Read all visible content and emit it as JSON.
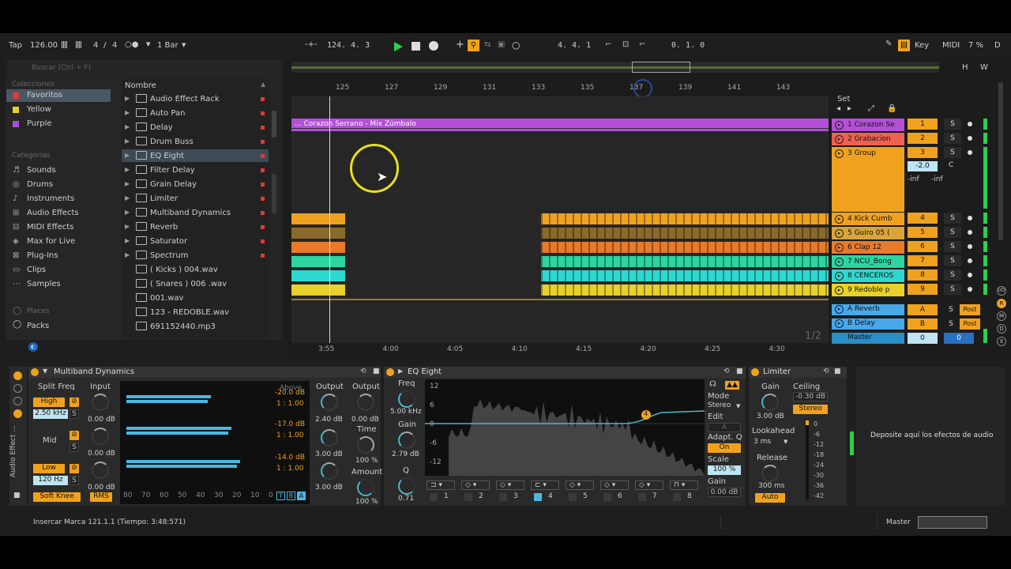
{
  "transport": {
    "tap": "Tap",
    "tempo": "126.00",
    "sig_num": "4",
    "sig_sep": "/",
    "sig_den": "4",
    "quant": "1 Bar",
    "position": "124.  4.  3",
    "loop_pos": "4.  4.  1",
    "loop_len": "0.  1.  0",
    "key": "Key",
    "midi": "MIDI",
    "cpu": "7 %",
    "d": "D"
  },
  "browser": {
    "search_placeholder": "Buscar (Ctrl + F)",
    "collections_title": "Colecciones",
    "collections": [
      {
        "label": "Favoritos",
        "color": "#e03a3a"
      },
      {
        "label": "Yellow",
        "color": "#e8d12a"
      },
      {
        "label": "Purple",
        "color": "#a64fd6"
      }
    ],
    "categories_title": "Categorías",
    "categories": [
      "Sounds",
      "Drums",
      "Instruments",
      "Audio Effects",
      "MIDI Effects",
      "Max for Live",
      "Plug-Ins",
      "Clips",
      "Samples"
    ],
    "places_title": "Places",
    "places": [
      "Packs"
    ],
    "name_header": "Nombre",
    "items": [
      "Audio Effect Rack",
      "Auto Pan",
      "Delay",
      "Drum Buss",
      "EQ Eight",
      "Filter Delay",
      "Grain Delay",
      "Limiter",
      "Multiband Dynamics",
      "Reverb",
      "Saturator",
      "Spectrum",
      "( Kicks ) 004.wav",
      "( Snares ) 006 .wav",
      "001.wav",
      "123 - REDOBLE.wav",
      "691152440.mp3"
    ]
  },
  "arrangement": {
    "ruler": [
      "125",
      "127",
      "129",
      "131",
      "133",
      "135",
      "137",
      "139",
      "141",
      "143"
    ],
    "time": [
      "3:55",
      "4:00",
      "4:05",
      "4:10",
      "4:15",
      "4:20",
      "4:25",
      "4:30"
    ],
    "clip_name": "... Corazon Serrano - Mix Zúmbalo",
    "set": "Set",
    "page": "1/2",
    "hw": [
      "H",
      "W"
    ]
  },
  "tracks": [
    {
      "name": "1 Corazon Se",
      "num": "1",
      "color": "#b44fd8"
    },
    {
      "name": "2 Grabacion",
      "num": "2",
      "color": "#f06050"
    },
    {
      "name": "3 Group",
      "num": "3",
      "color": "#f0a21f"
    },
    {
      "name": "4 Kick Cumb",
      "num": "4",
      "color": "#f0a21f"
    },
    {
      "name": "5 Guiro 05 (",
      "num": "5",
      "color": "#d9a53a"
    },
    {
      "name": "6 Clap 12",
      "num": "6",
      "color": "#e87a2a"
    },
    {
      "name": "7 NCU_Bong",
      "num": "7",
      "color": "#2bd6a0"
    },
    {
      "name": "8 CENCEROS",
      "num": "8",
      "color": "#2ed8d0"
    },
    {
      "name": "9 Redoble p",
      "num": "9",
      "color": "#e8d12a"
    }
  ],
  "returns": [
    {
      "name": "A Reverb",
      "num": "A",
      "post": "Post"
    },
    {
      "name": "B Delay",
      "num": "B",
      "post": "Post"
    }
  ],
  "master": {
    "name": "Master",
    "a": "0",
    "b": "0"
  },
  "group_mixer": {
    "vol": "-2.0",
    "pan": "C",
    "l": "-inf",
    "r": "-inf"
  },
  "solo": "S",
  "chain_title": "Audio Effect ...",
  "multiband": {
    "title": "Multiband Dynamics",
    "split_freq": "Split Freq",
    "input": "Input",
    "output": "Output",
    "high": "High",
    "high_freq": "2.50 kHz",
    "mid": "Mid",
    "low": "Low",
    "low_freq": "120 Hz",
    "in_vals": [
      "0.00 dB",
      "0.00 dB",
      "0.00 dB"
    ],
    "above": "Above",
    "thr": [
      "-20.0 dB",
      "-17.0 dB",
      "-14.0 dB"
    ],
    "ratio": [
      "1 : 1.00",
      "1 : 1.00",
      "1 : 1.00"
    ],
    "out_vals": [
      "2.40 dB",
      "3.00 dB",
      "3.00 dB"
    ],
    "out2": "0.00 dB",
    "time": "Time",
    "time_val": "100 %",
    "amount": "Amount",
    "amount_val": "100 %",
    "scale": [
      "80",
      "70",
      "60",
      "50",
      "40",
      "30",
      "20",
      "10",
      "0"
    ],
    "tba": [
      "T",
      "B",
      "A"
    ],
    "soft_knee": "Soft Knee",
    "rms": "RMS",
    "meter_levels": [
      0.72,
      0.9,
      0.97
    ]
  },
  "eq": {
    "title": "EQ Eight",
    "freq": "Freq",
    "freq_val": "5.00 kHz",
    "gain": "Gain",
    "gain_val": "2.79 dB",
    "q": "Q",
    "q_val": "0.71",
    "db_ticks": [
      "12",
      "6",
      "0",
      "-6",
      "-12"
    ],
    "hz_ticks": [
      "100",
      "1k",
      "10k"
    ],
    "mode": "Mode",
    "mode_val": "Stereo",
    "edit": "Edit",
    "edit_val": "A",
    "adapt": "Adapt. Q",
    "adapt_val": "On",
    "scale": "Scale",
    "scale_val": "100 %",
    "gain2": "Gain",
    "gain2_val": "0.00 dB",
    "bands": [
      "1",
      "2",
      "3",
      "4",
      "5",
      "6",
      "7",
      "8"
    ],
    "active_band": "4"
  },
  "limiter": {
    "title": "Limiter",
    "gain": "Gain",
    "gain_val": "3.00 dB",
    "ceiling": "Ceiling",
    "ceiling_val": "-0.30 dB",
    "stereo": "Stereo",
    "lookahead": "Lookahead",
    "lookahead_val": "3 ms",
    "release": "Release",
    "release_val": "300 ms",
    "auto": "Auto",
    "scale": [
      "0",
      "-6",
      "-12",
      "-18",
      "-24",
      "-30",
      "-36",
      "-42"
    ]
  },
  "drop_hint": "Deposite aquí los efectos de audio",
  "status": {
    "text": "Insercar Marca 121.1.1 (Tiempo: 3:48:571)",
    "master": "Master"
  }
}
